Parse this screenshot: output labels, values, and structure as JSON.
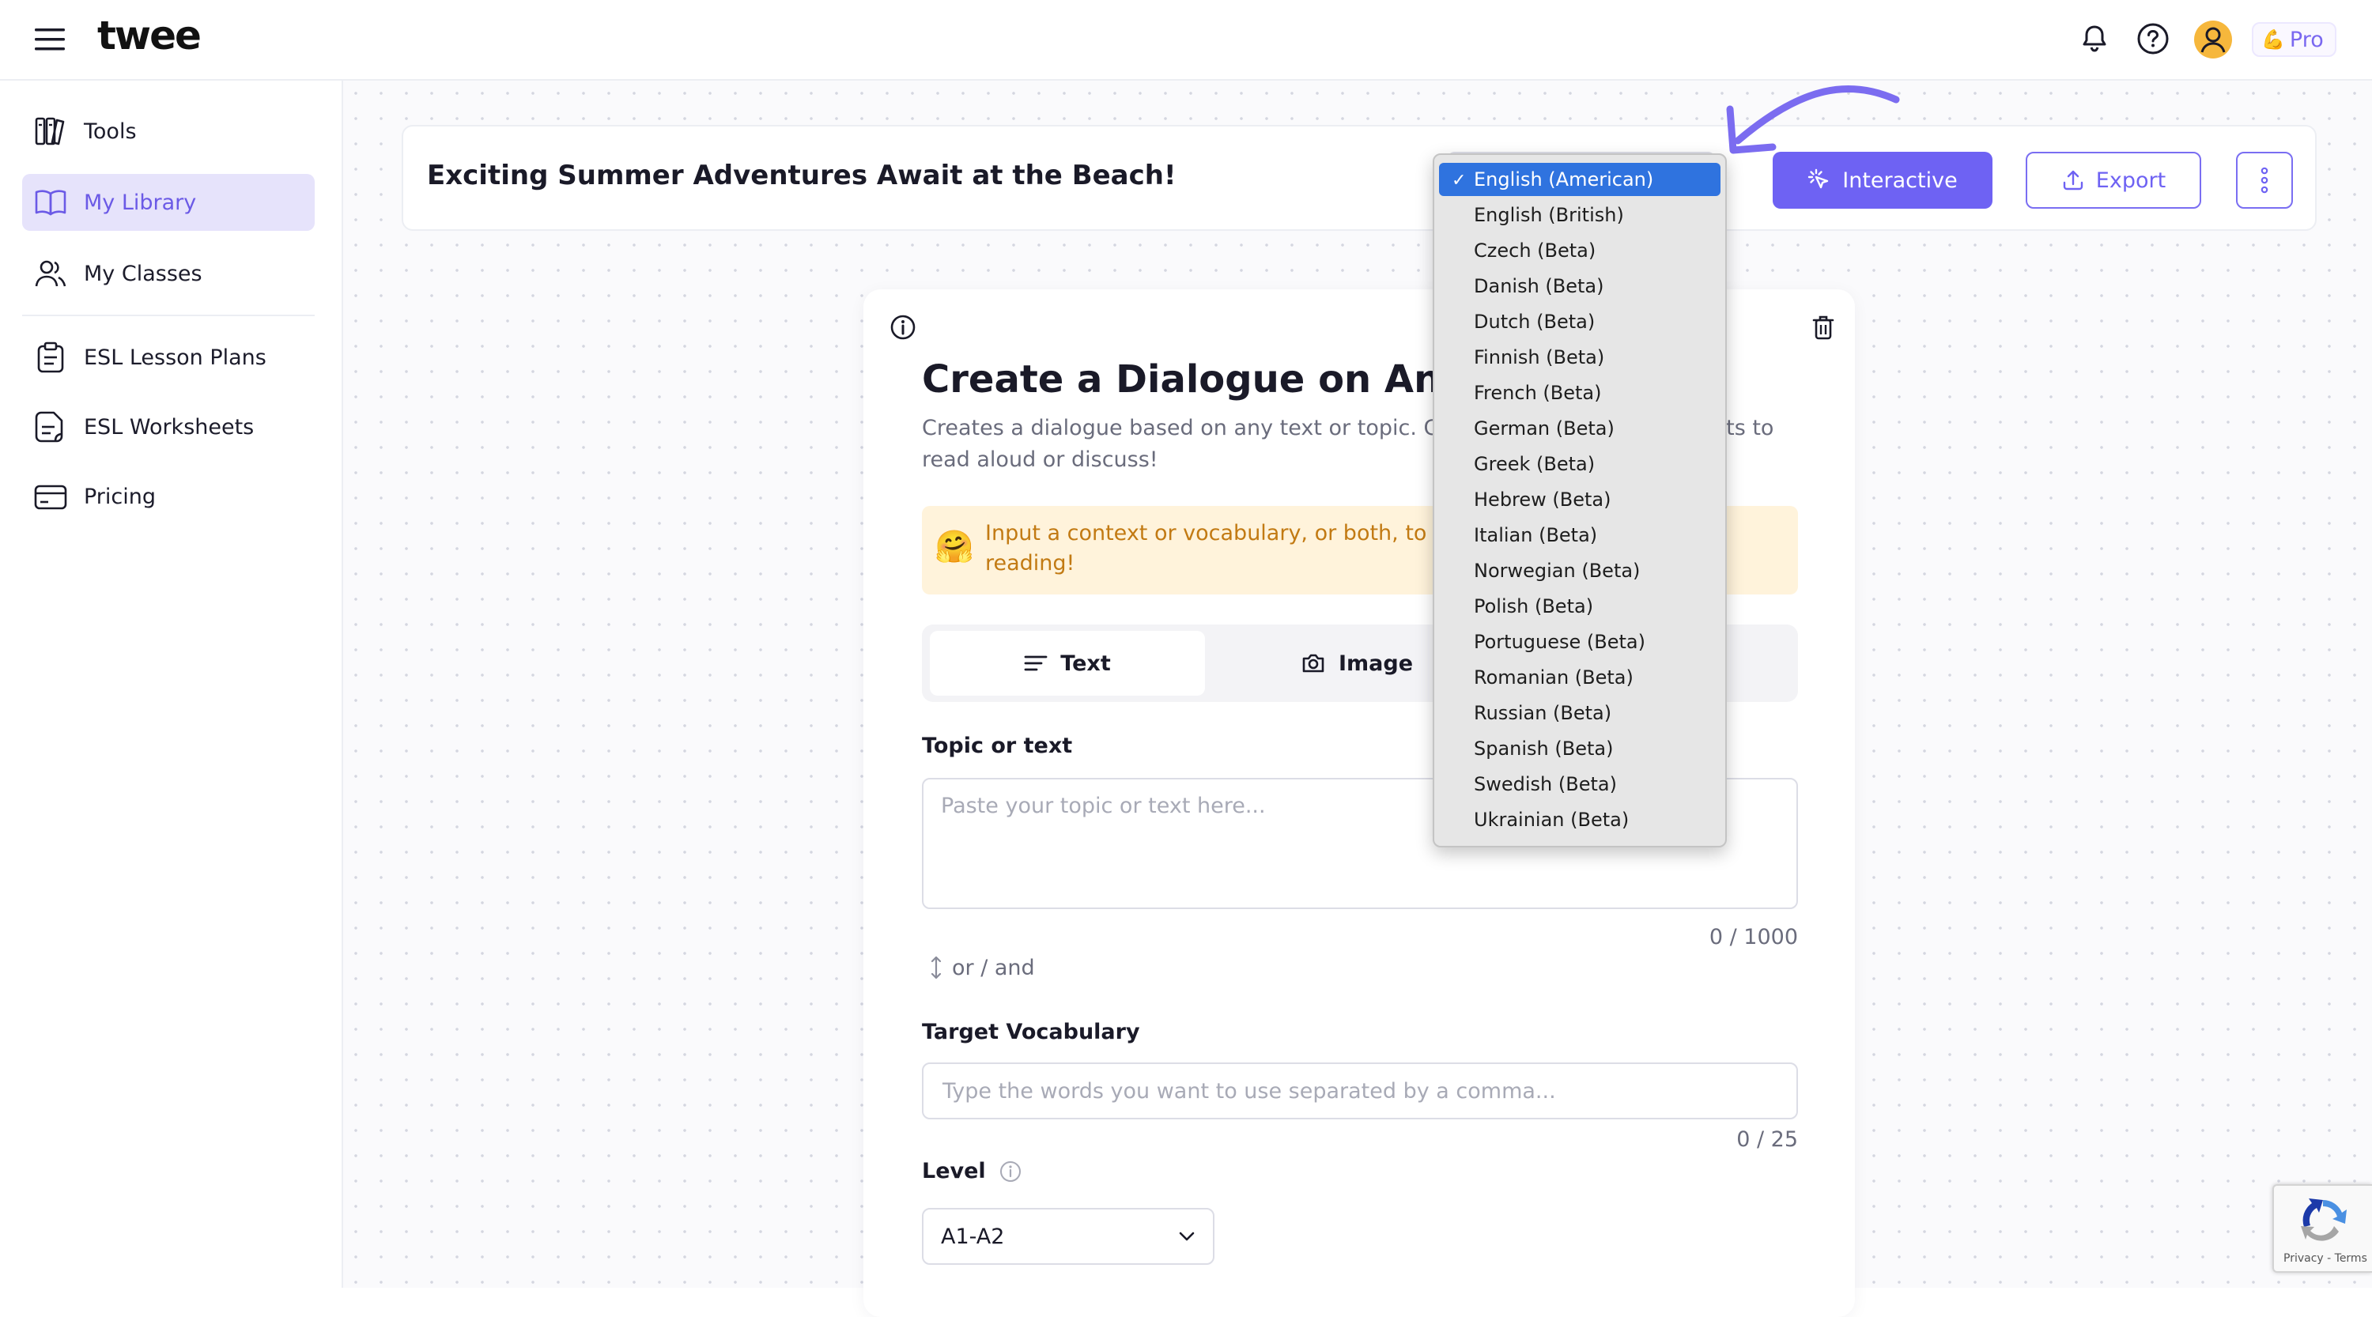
{
  "app": {
    "logo": "twee",
    "pro_label": "Pro",
    "pro_emoji": "💪"
  },
  "sidebar": {
    "items": [
      {
        "label": "Tools",
        "icon": "tools-icon"
      },
      {
        "label": "My Library",
        "icon": "book-icon",
        "active": true
      },
      {
        "label": "My Classes",
        "icon": "users-icon"
      },
      {
        "label": "ESL Lesson Plans",
        "icon": "clipboard-icon"
      },
      {
        "label": "ESL Worksheets",
        "icon": "worksheet-icon"
      },
      {
        "label": "Pricing",
        "icon": "credit-card-icon"
      }
    ]
  },
  "header": {
    "doc_title": "Exciting Summer Adventures Await at the Beach!",
    "interactive_label": "Interactive",
    "export_label": "Export"
  },
  "tool": {
    "title": "Create a Dialogue on Any Top",
    "description": "Creates a dialogue based on any text or topic. Giv",
    "description_right": "nts to",
    "description_line2": "read aloud or discuss!",
    "hint_emoji": "🤗",
    "hint_text": "Input a context or vocabulary, or both, to cr",
    "hint_text_line2": "reading!",
    "tabs": [
      {
        "label": "Text",
        "icon": "text-lines-icon",
        "active": true
      },
      {
        "label": "Image",
        "icon": "camera-icon"
      }
    ],
    "topic_label": "Topic or text",
    "topic_placeholder": "Paste your topic or text here...",
    "topic_counter": "0 / 1000",
    "or_and": "or / and",
    "vocab_label": "Target Vocabulary",
    "vocab_placeholder": "Type the words you want to use separated by a comma...",
    "vocab_counter": "0 / 25",
    "level_label": "Level",
    "level_value": "A1-A2"
  },
  "language_dropdown": {
    "selected_mark": "✓",
    "options": [
      "English (American)",
      "English (British)",
      "Czech (Beta)",
      "Danish (Beta)",
      "Dutch (Beta)",
      "Finnish (Beta)",
      "French (Beta)",
      "German (Beta)",
      "Greek (Beta)",
      "Hebrew (Beta)",
      "Italian (Beta)",
      "Norwegian (Beta)",
      "Polish (Beta)",
      "Portuguese (Beta)",
      "Romanian (Beta)",
      "Russian (Beta)",
      "Spanish (Beta)",
      "Swedish (Beta)",
      "Ukrainian (Beta)"
    ],
    "selected_index": 0
  },
  "recaptcha": {
    "links": "Privacy - Terms"
  },
  "colors": {
    "accent": "#6e62f3",
    "active_nav_bg": "#e6e3fb",
    "hint_bg": "#fff3db",
    "hint_text": "#c27a13",
    "dropdown_selected": "#2f73df"
  }
}
